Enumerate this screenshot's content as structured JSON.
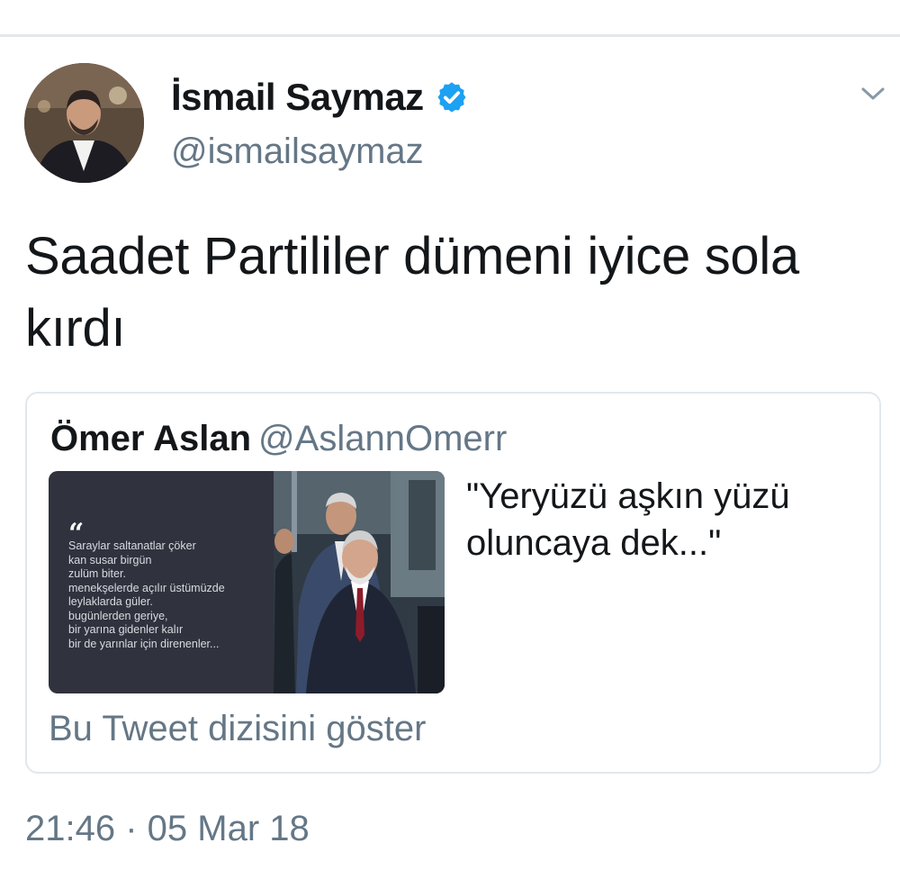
{
  "author": {
    "display_name": "İsmail Saymaz",
    "handle": "@ismailsaymaz",
    "verified": true,
    "avatar_icon": "user-photo"
  },
  "tweet": {
    "text": "Saadet Partililer dümeni iyice sola kırdı",
    "timestamp": "21:46 · 05 Mar 18"
  },
  "quoted_tweet": {
    "display_name": "Ömer Aslan",
    "handle": "@AslannOmerr",
    "text": "\"Yeryüzü aşkın yüzü oluncaya dek...\"",
    "image_poem": "Saraylar saltanatlar çöker\nkan susar birgün\nzulüm biter.\nmenekşelerde açılır üstümüzde\nleylaklarda güler.\nbugünlerden geriye,\nbir yarına gidenler kalır\nbir de yarınlar için direnenler...",
    "show_thread_label": "Bu Tweet dizisini göster"
  },
  "colors": {
    "primary_text": "#14171a",
    "secondary_text": "#657786",
    "verified_blue": "#1da1f2",
    "border": "#e1e8ed"
  },
  "icons": {
    "verified": "verified-badge-icon",
    "menu": "chevron-down-icon"
  }
}
